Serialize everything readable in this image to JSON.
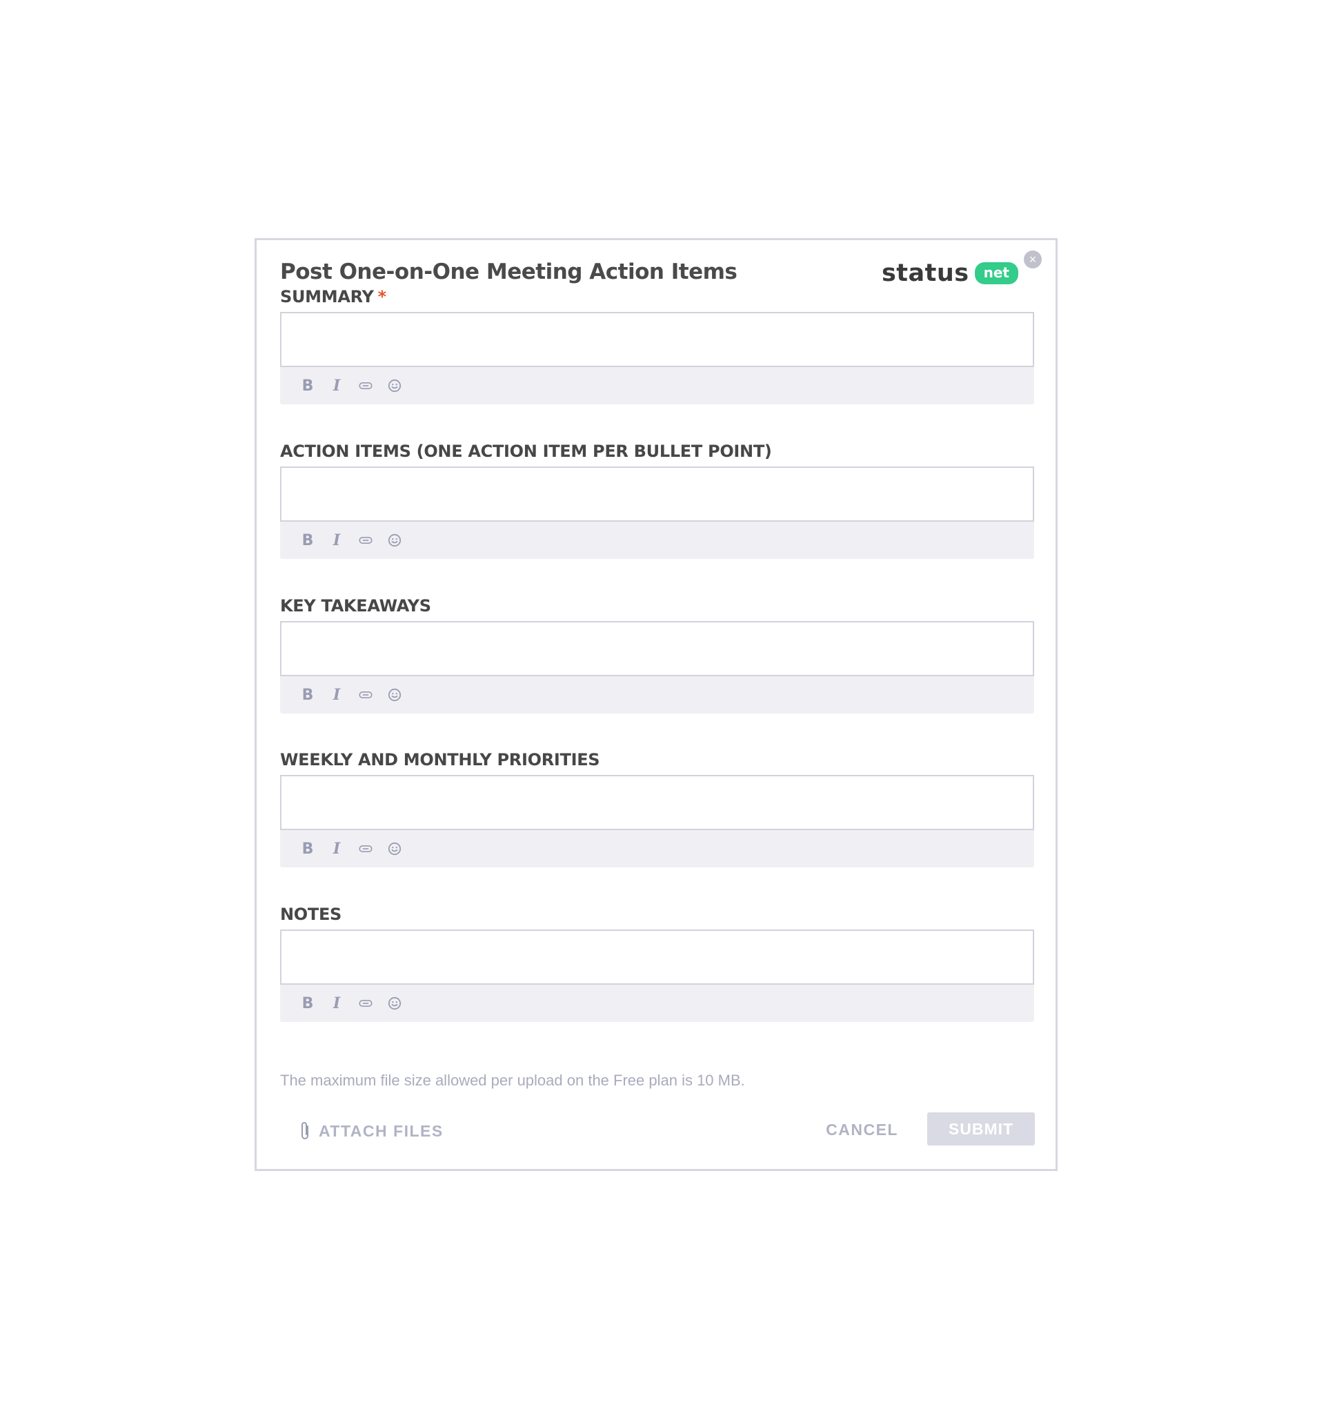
{
  "form": {
    "title": "Post One-on-One Meeting Action Items",
    "close_label": "×",
    "logo": {
      "text": "status",
      "badge": "net",
      "badge_color": "#33cc8a"
    },
    "fields": [
      {
        "label": "SUMMARY",
        "required": true,
        "required_mark": "*",
        "value": ""
      },
      {
        "label": "ACTION ITEMS (ONE ACTION ITEM PER BULLET POINT)",
        "required": false,
        "value": ""
      },
      {
        "label": "KEY TAKEAWAYS",
        "required": false,
        "value": ""
      },
      {
        "label": "WEEKLY AND MONTHLY PRIORITIES",
        "required": false,
        "value": ""
      },
      {
        "label": "NOTES",
        "required": false,
        "value": ""
      }
    ],
    "toolbar": {
      "bold": "B",
      "italic": "I",
      "link": "link-icon",
      "emoji": "emoji-icon"
    },
    "upload_note": "The maximum file size allowed per upload on the Free plan is 10 MB.",
    "attach_label": "ATTACH FILES",
    "cancel_label": "CANCEL",
    "submit_label": "SUBMIT"
  }
}
